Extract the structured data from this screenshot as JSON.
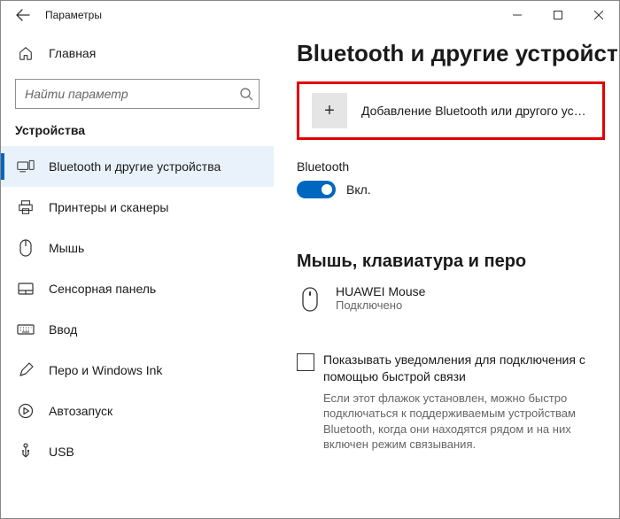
{
  "titlebar": {
    "title": "Параметры"
  },
  "sidebar": {
    "home": "Главная",
    "search_placeholder": "Найти параметр",
    "section": "Устройства",
    "items": [
      {
        "label": "Bluetooth и другие устройства"
      },
      {
        "label": "Принтеры и сканеры"
      },
      {
        "label": "Мышь"
      },
      {
        "label": "Сенсорная панель"
      },
      {
        "label": "Ввод"
      },
      {
        "label": "Перо и Windows Ink"
      },
      {
        "label": "Автозапуск"
      },
      {
        "label": "USB"
      }
    ]
  },
  "main": {
    "heading": "Bluetooth и другие устройства",
    "add_label": "Добавление Bluetooth или другого устройс...",
    "bt_label": "Bluetooth",
    "bt_state": "Вкл.",
    "group_heading": "Мышь, клавиатура и перо",
    "device": {
      "name": "HUAWEI  Mouse",
      "status": "Подключено"
    },
    "checkbox_label": "Показывать уведомления для подключения с помощью быстрой связи",
    "hint": "Если этот флажок установлен, можно быстро подключаться к поддерживаемым устройствам Bluetooth, когда они находятся рядом и на них включен режим связывания."
  }
}
